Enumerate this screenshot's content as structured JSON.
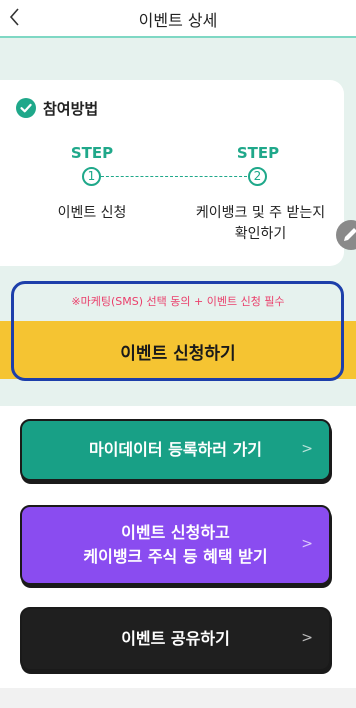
{
  "header": {
    "title": "이벤트 상세",
    "back_icon": "chevron-left-icon"
  },
  "how_to": {
    "title": "참여방법",
    "steps": [
      {
        "label": "STEP",
        "number": "1",
        "desc_line1": "이벤트 신청",
        "desc_line2": ""
      },
      {
        "label": "STEP",
        "number": "2",
        "desc_line1": "케이뱅크 및 주 받는지",
        "desc_line2": "확인하기"
      }
    ]
  },
  "apply": {
    "notice": "※마케팅(SMS) 선택 동의 + 이벤트 신청 필수",
    "button_label": "이벤트 신청하기"
  },
  "buttons": {
    "mydata": {
      "label": "마이데이터 등록하러 가기",
      "chevron": ">"
    },
    "benefit": {
      "label_line1": "이벤트 신청하고",
      "label_line2": "케이뱅크 주식 등 혜택 받기",
      "chevron": ">"
    },
    "share": {
      "label": "이벤트 공유하기",
      "chevron": ">"
    }
  },
  "colors": {
    "accent_green": "#1fa88a",
    "apply_yellow": "#f5c432",
    "notice_pink": "#ea3f6b",
    "purple": "#8a4cf0",
    "highlight_blue": "#1d3faa"
  }
}
